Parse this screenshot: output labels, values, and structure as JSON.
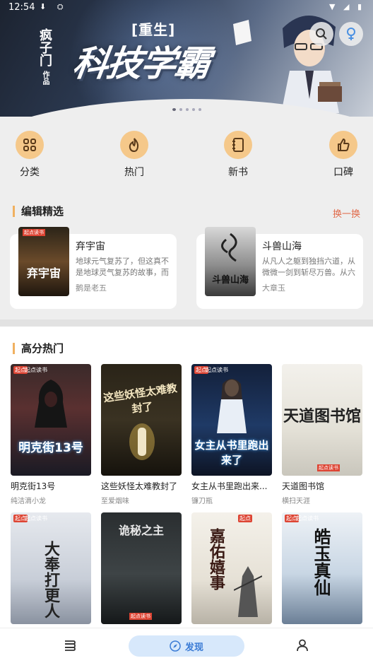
{
  "status": {
    "time": "12:54"
  },
  "banner": {
    "subtitle": "[重生]",
    "title": "科技学霸",
    "author_mark": "疯子门",
    "works": "作品"
  },
  "categories": [
    {
      "label": "分类",
      "icon": "grid-icon"
    },
    {
      "label": "热门",
      "icon": "flame-icon"
    },
    {
      "label": "新书",
      "icon": "book-icon"
    },
    {
      "label": "口碑",
      "icon": "thumbs-up-icon"
    }
  ],
  "editor_picks": {
    "title": "编辑精选",
    "swap_label": "换一换",
    "items": [
      {
        "title": "弃宇宙",
        "desc": "地球元气复苏了，但这真不是地球灵气复苏的故事，而是一...",
        "author": "鹅是老五",
        "cover_text": "弃宇宙"
      },
      {
        "title": "斗兽山海",
        "desc": "从凡人之躯到独挡六道，从微微一剑到斩尽万兽。从六神创...",
        "author": "大章玉",
        "cover_text": "斗兽山海"
      }
    ]
  },
  "hot": {
    "title": "高分热门",
    "books": [
      {
        "title": "明克街13号",
        "author": "纯洁滴小龙",
        "cover_text": "明克街13号",
        "badge": "起点读书"
      },
      {
        "title": "这些妖怪太难教封了",
        "author": "至爱烟味",
        "cover_text": "这些妖怪太难教封了",
        "badge": ""
      },
      {
        "title": "女主从书里跑出来...",
        "author": "镰刀瓶",
        "cover_text": "女主从书里跑出来了",
        "badge": "起点读书"
      },
      {
        "title": "天道图书馆",
        "author": "横扫天涯",
        "cover_text": "天道图书馆",
        "badge": "起点读书"
      },
      {
        "title": "",
        "author": "",
        "cover_text": "大奉打更人",
        "badge": "起点读书"
      },
      {
        "title": "",
        "author": "",
        "cover_text": "诡秘之主",
        "badge": "起点读书"
      },
      {
        "title": "",
        "author": "",
        "cover_text": "嘉佑嬉事",
        "badge": "起点读书"
      },
      {
        "title": "",
        "author": "",
        "cover_text": "皓玉真仙",
        "badge": "起点读书"
      }
    ]
  },
  "nav": {
    "discover": "发现"
  }
}
